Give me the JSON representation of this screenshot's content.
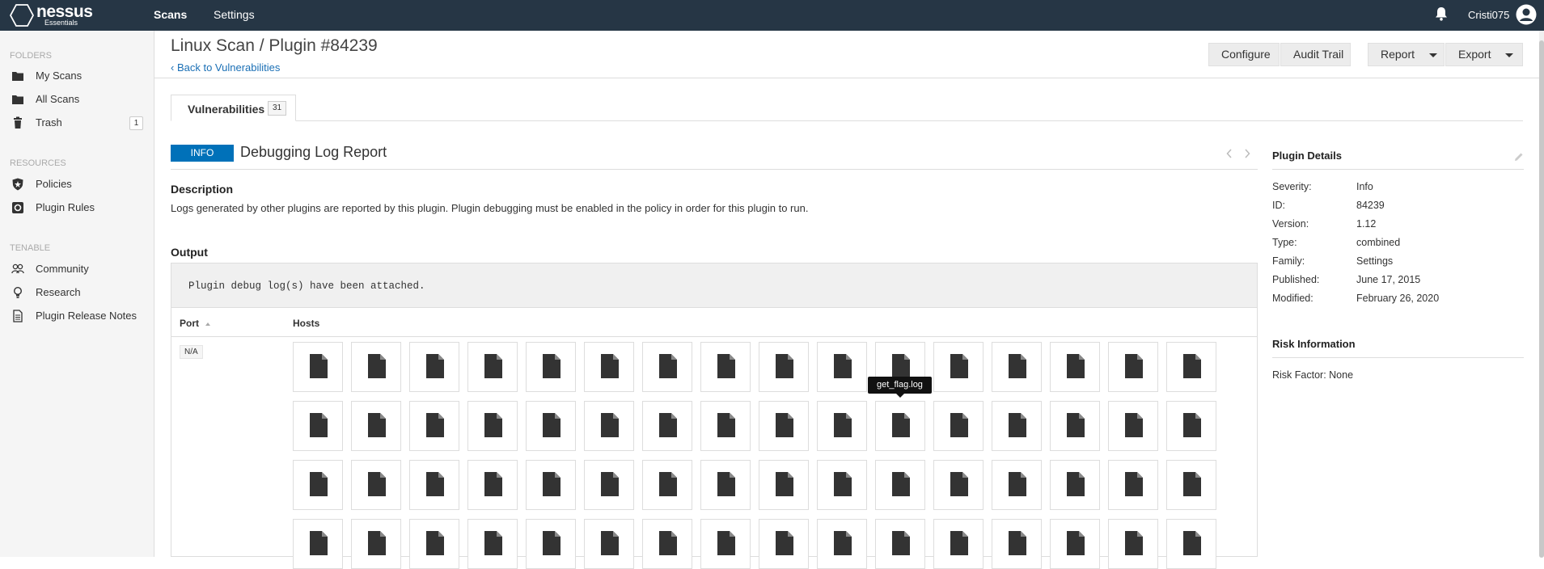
{
  "app": {
    "logo_name": "nessus",
    "logo_sub": "Essentials",
    "nav": [
      "Scans",
      "Settings"
    ],
    "username": "Cristi075"
  },
  "sidebar": {
    "sections": [
      {
        "header": "FOLDERS",
        "items": [
          {
            "label": "My Scans",
            "icon": "folder-icon"
          },
          {
            "label": "All Scans",
            "icon": "folder-icon"
          },
          {
            "label": "Trash",
            "icon": "trash-icon",
            "badge": "1"
          }
        ]
      },
      {
        "header": "RESOURCES",
        "items": [
          {
            "label": "Policies",
            "icon": "shield-icon"
          },
          {
            "label": "Plugin Rules",
            "icon": "plugin-rules-icon"
          }
        ]
      },
      {
        "header": "TENABLE",
        "items": [
          {
            "label": "Community",
            "icon": "community-icon"
          },
          {
            "label": "Research",
            "icon": "lightbulb-icon"
          },
          {
            "label": "Plugin Release Notes",
            "icon": "document-icon"
          }
        ]
      }
    ]
  },
  "header": {
    "title": "Linux Scan / Plugin #84239",
    "back_link": "Back to Vulnerabilities",
    "buttons": {
      "configure": "Configure",
      "audit_trail": "Audit Trail",
      "report": "Report",
      "export": "Export"
    }
  },
  "tabs": [
    {
      "label": "Vulnerabilities",
      "count": "31"
    }
  ],
  "vulnerability": {
    "severity": "INFO",
    "title": "Debugging Log Report",
    "description_heading": "Description",
    "description": "Logs generated by other plugins are reported by this plugin. Plugin debugging must be enabled in the policy in order for this plugin to run.",
    "output_heading": "Output",
    "output_text": "Plugin debug log(s) have been attached.",
    "columns": {
      "port": "Port",
      "hosts": "Hosts"
    },
    "port": "N/A",
    "attachment_tooltip": "get_flag.log",
    "attachment_icon": "file-icon"
  },
  "plugin_details": {
    "title": "Plugin Details",
    "rows": [
      {
        "label": "Severity:",
        "value": "Info"
      },
      {
        "label": "ID:",
        "value": "84239"
      },
      {
        "label": "Version:",
        "value": "1.12"
      },
      {
        "label": "Type:",
        "value": "combined"
      },
      {
        "label": "Family:",
        "value": "Settings"
      },
      {
        "label": "Published:",
        "value": "June 17, 2015"
      },
      {
        "label": "Modified:",
        "value": "February 26, 2020"
      }
    ]
  },
  "risk_information": {
    "title": "Risk Information",
    "risk_factor": "Risk Factor: None"
  },
  "colors": {
    "topbar": "#263645",
    "info_badge": "#0071b9",
    "link": "#1a6fb5"
  }
}
